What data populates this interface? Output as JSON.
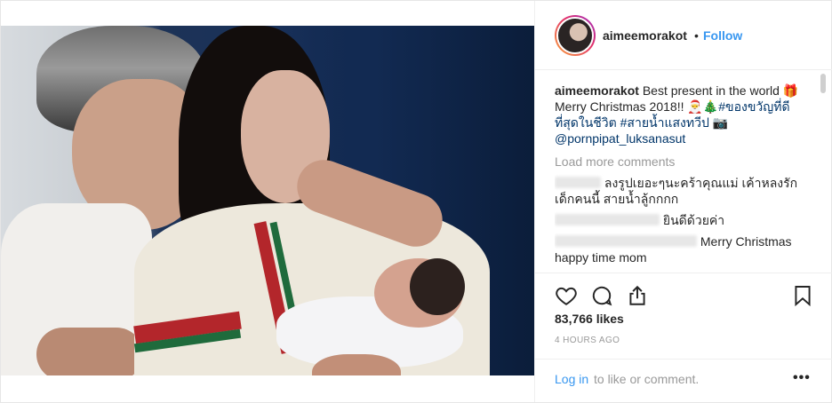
{
  "post": {
    "username": "aimeemorakot",
    "separator": "•",
    "follow_label": "Follow",
    "caption": {
      "user": "aimeemorakot",
      "text1": " Best present in the world ",
      "emoji1": "🎁",
      "text2": "Merry Christmas 2018!! ",
      "emoji2": "🎅🎄",
      "hashtag1": "#ของขวัญที่ดีที่สุดในชีวิต",
      "hashtag2": "#สายน้ำแสงทวีป",
      "emoji3": "📷",
      "mention": "@pornpipat_luksanasut"
    },
    "load_more": "Load more comments",
    "comments": [
      {
        "text": "ลงรูปเยอะๆนะคร้าคุณแม่ เค้าหลงรักเด็กคนนี้ สายน้ำลู้กกกก"
      },
      {
        "text": "ยินดีด้วยค่า"
      },
      {
        "text": "Merry Christmas happy time mom"
      }
    ],
    "likes": "83,766 likes",
    "time": "4 HOURS AGO",
    "login_link": "Log in",
    "login_rest": "to like or comment.",
    "more_label": "•••"
  },
  "icons": {
    "like": "heart-icon",
    "comment": "comment-icon",
    "share": "share-icon",
    "save": "bookmark-icon",
    "more": "more-icon"
  },
  "colors": {
    "link": "#3897f0",
    "hashtag": "#003569",
    "muted": "#999999"
  }
}
